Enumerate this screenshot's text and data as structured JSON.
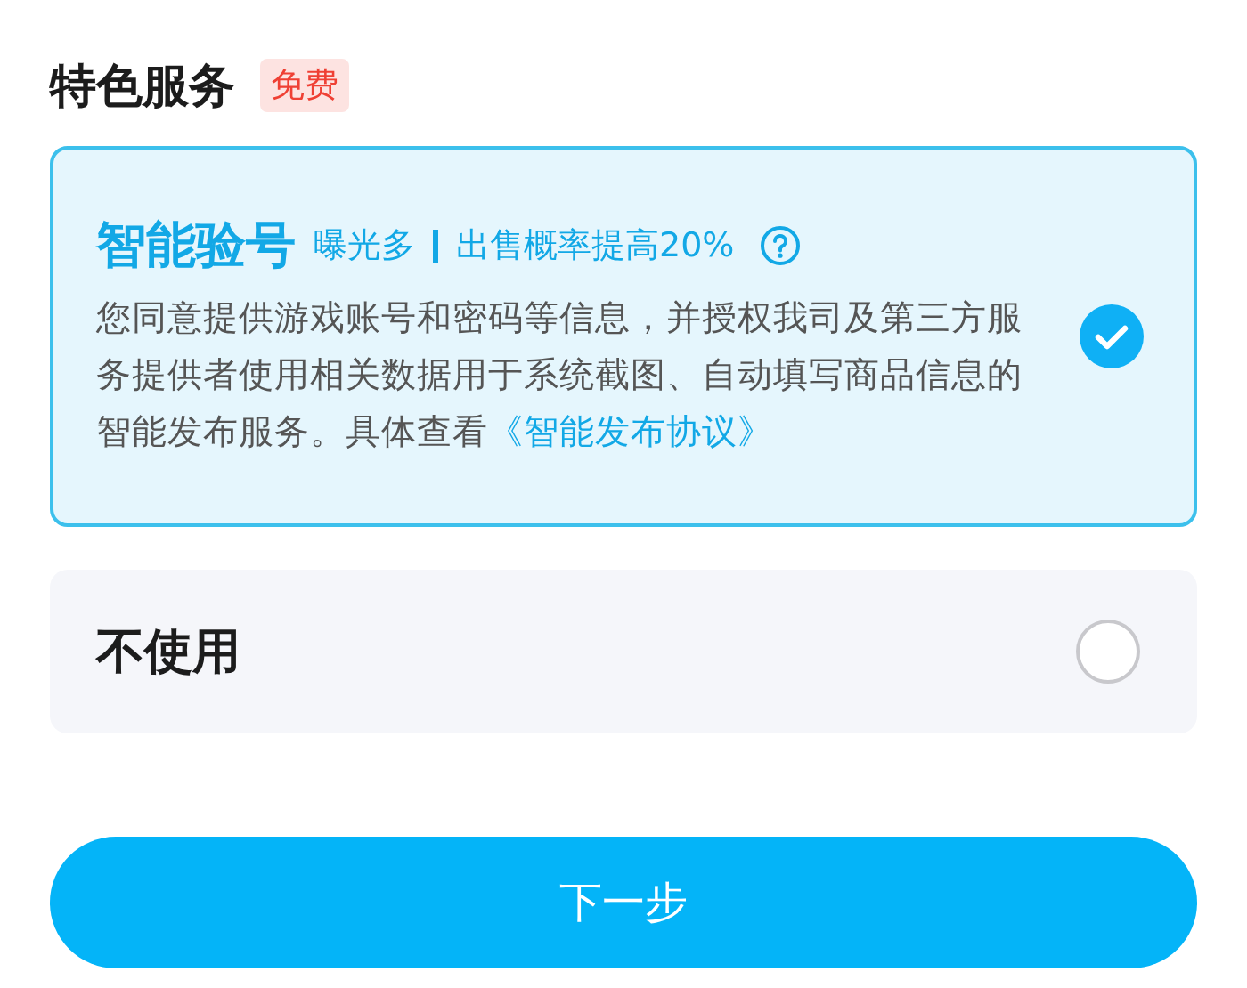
{
  "section": {
    "title": "特色服务",
    "badge": "免费"
  },
  "options": [
    {
      "kind": "detailed",
      "title": "智能验号",
      "tags": [
        "曝光多",
        "出售概率提高20%"
      ],
      "description": "您同意提供游戏账号和密码等信息，并授权我司及第三方服务提供者使用相关数据用于系统截图、自动填写商品信息的智能发布服务。具体查看",
      "link": "《智能发布协议》",
      "selected": true
    },
    {
      "kind": "plain",
      "title": "不使用",
      "selected": false
    }
  ],
  "button": "下一步"
}
